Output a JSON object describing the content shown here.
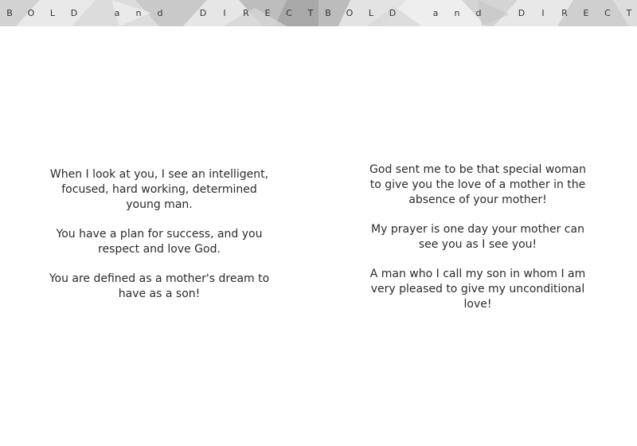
{
  "banner": {
    "letters": [
      "B",
      "O",
      "L",
      "D",
      "",
      "a",
      "n",
      "d",
      "",
      "D",
      "I",
      "R",
      "E",
      "C",
      "T"
    ]
  },
  "pages": {
    "left": {
      "paragraphs": [
        "When I look at you, I see an intelligent, focused, hard working, determined young man.",
        "You have a plan for success, and you respect and love God.",
        "You are defined as a mother's dream to have as a son!"
      ]
    },
    "right": {
      "paragraphs": [
        "God sent me to be that special woman to give you the love of a mother in the absence of your mother!",
        "My prayer is one day your mother can see you as I see you!",
        "A man who I call my son in whom I am very pleased to give my unconditional love!"
      ]
    }
  }
}
